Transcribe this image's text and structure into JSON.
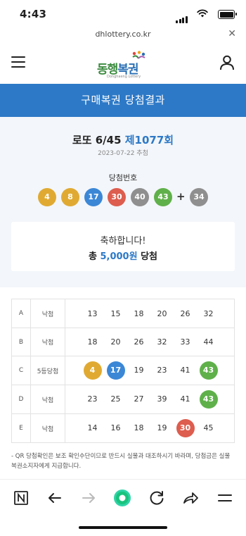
{
  "status": {
    "time": "4:43"
  },
  "browser": {
    "url": "dhlottery.co.kr"
  },
  "header": {
    "logo_text_a": "동행",
    "logo_text_b": "복권",
    "logo_sub": "Donghaeng Lottery"
  },
  "title": "구매복권 당첨결과",
  "result": {
    "round_prefix": "로또 6/45",
    "round_no": "제1077회",
    "date": "2023-07-22 추첨",
    "winning_label": "당첨번호",
    "winning_numbers": [
      4,
      8,
      17,
      30,
      40,
      43
    ],
    "bonus": 34,
    "plus": "+"
  },
  "congrats": {
    "line1": "축하합니다!",
    "prefix": "총",
    "amount": "5,000원",
    "suffix": "당첨"
  },
  "tickets": [
    {
      "label": "A",
      "result": "낙첨",
      "numbers": [
        13,
        15,
        18,
        20,
        26,
        32
      ]
    },
    {
      "label": "B",
      "result": "낙첨",
      "numbers": [
        18,
        20,
        26,
        32,
        33,
        44
      ]
    },
    {
      "label": "C",
      "result": "5등당첨",
      "numbers": [
        4,
        17,
        19,
        23,
        41,
        43
      ]
    },
    {
      "label": "D",
      "result": "낙첨",
      "numbers": [
        23,
        25,
        27,
        39,
        41,
        43
      ]
    },
    {
      "label": "E",
      "result": "낙첨",
      "numbers": [
        14,
        16,
        18,
        19,
        30,
        45
      ]
    }
  ],
  "notice": "- QR 당첨확인은 보조 확인수단이므로 반드시 실물과 대조하시기 바라며, 당첨금은 실물 복권소지자에게 지급합니다.",
  "colors": {
    "yellow": "#e0aa32",
    "blue": "#3b87d6",
    "red": "#dd5d4e",
    "gray": "#8f8f8f",
    "green": "#5fb04a",
    "title": "#2d79c7"
  },
  "toolbar": {
    "icons": [
      "naver-icon",
      "back-icon",
      "forward-icon",
      "green-dot-icon",
      "reload-icon",
      "share-icon",
      "menu-icon"
    ]
  }
}
